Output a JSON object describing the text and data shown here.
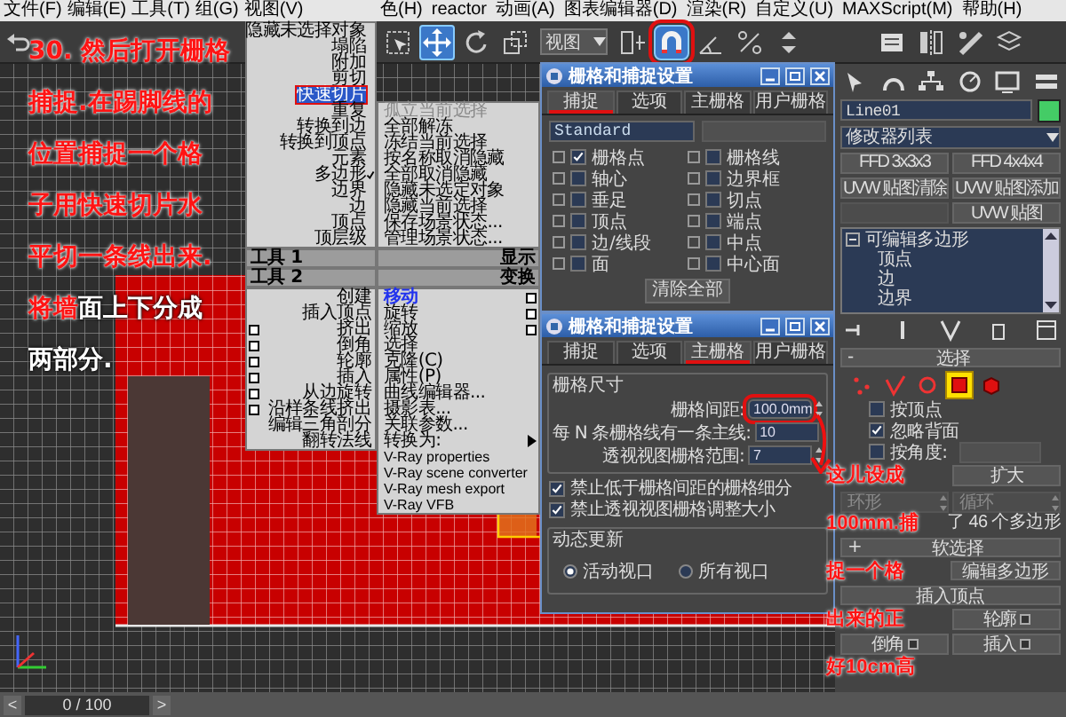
{
  "menu_bar": {
    "left_items": [
      "文件(F)",
      "编辑(E)",
      "工具(T)",
      "组(G)",
      "视图(V)"
    ],
    "right_items": [
      "色(H)",
      "reactor",
      "动画(A)",
      "图表编辑器(D)",
      "渲染(R)",
      "自定义(U)",
      "MAXScript(M)",
      "帮助(H)"
    ]
  },
  "toolbar": {
    "view_dropdown": "视图",
    "tools": [
      {
        "active": false
      },
      {
        "active": true
      },
      {
        "active": false
      },
      {
        "active": false
      },
      {
        "active": false
      },
      {
        "active": true
      },
      {
        "active": false
      },
      {
        "active": false
      },
      {
        "active": false
      },
      {
        "active": false
      },
      {
        "active": false
      },
      {
        "active": false
      },
      {
        "active": false
      }
    ]
  },
  "quad_menu": {
    "top_left": [
      {
        "label": "隐藏未选择对象",
        "checked": false,
        "highlighted": false
      },
      {
        "label": "塌陷",
        "checked": false,
        "highlighted": false
      },
      {
        "label": "附加",
        "checked": false,
        "highlighted": false
      },
      {
        "label": "剪切",
        "checked": false,
        "highlighted": false
      },
      {
        "label": "快速切片",
        "checked": false,
        "highlighted": true
      },
      {
        "label": "重复",
        "checked": false,
        "highlighted": false
      },
      {
        "label": "转换到边",
        "checked": false,
        "highlighted": false
      },
      {
        "label": "转换到顶点",
        "checked": false,
        "highlighted": false
      },
      {
        "label": "元素",
        "checked": false,
        "highlighted": false
      },
      {
        "label": "多边形",
        "checked": true,
        "highlighted": false
      },
      {
        "label": "边界",
        "checked": false,
        "highlighted": false
      },
      {
        "label": "边",
        "checked": false,
        "highlighted": false
      },
      {
        "label": "顶点",
        "checked": false,
        "highlighted": false
      },
      {
        "label": "顶层级",
        "checked": false,
        "highlighted": false
      }
    ],
    "top_right": [
      {
        "label": "孤立当前选择",
        "disabled": true
      },
      {
        "label": "全部解冻",
        "disabled": false
      },
      {
        "label": "冻结当前选择",
        "disabled": false
      },
      {
        "label": "按名称取消隐藏",
        "disabled": false
      },
      {
        "label": "全部取消隐藏",
        "disabled": false
      },
      {
        "label": "隐藏未选定对象",
        "disabled": false
      },
      {
        "label": "隐藏当前选择",
        "disabled": false
      },
      {
        "label": "保存场景状态...",
        "disabled": false
      },
      {
        "label": "管理场景状态...",
        "disabled": false
      }
    ],
    "headers": [
      "工具 1",
      "显示",
      "工具 2",
      "变换"
    ],
    "bottom_left": [
      {
        "label": "创建",
        "has_options": false
      },
      {
        "label": "插入顶点",
        "has_options": false
      },
      {
        "label": "挤出",
        "has_options": true
      },
      {
        "label": "倒角",
        "has_options": true
      },
      {
        "label": "轮廓",
        "has_options": true
      },
      {
        "label": "插入",
        "has_options": true
      },
      {
        "label": "从边旋转",
        "has_options": true
      },
      {
        "label": "沿样条线挤出",
        "has_options": true
      },
      {
        "label": "编辑三角剖分",
        "has_options": false
      },
      {
        "label": "翻转法线",
        "has_options": false
      }
    ],
    "bottom_right": [
      {
        "kind": "item",
        "label": "移动",
        "has_options": true,
        "current": true
      },
      {
        "kind": "item",
        "label": "旋转",
        "has_options": true,
        "current": false
      },
      {
        "kind": "item",
        "label": "缩放",
        "has_options": true,
        "current": false
      },
      {
        "kind": "item",
        "label": "选择",
        "has_options": false,
        "current": false
      },
      {
        "kind": "item",
        "label": "克隆(C)",
        "has_options": false,
        "current": false
      },
      {
        "kind": "item",
        "label": "属性(P)",
        "has_options": false,
        "current": false
      },
      {
        "kind": "item",
        "label": "曲线编辑器...",
        "has_options": false,
        "current": false
      },
      {
        "kind": "item",
        "label": "摄影表...",
        "has_options": false,
        "current": false
      },
      {
        "kind": "item",
        "label": "关联参数...",
        "has_options": false,
        "current": false
      },
      {
        "kind": "submenu",
        "label": "转换为:",
        "has_options": false,
        "current": false
      },
      {
        "kind": "item",
        "label": "V-Ray properties",
        "has_options": false,
        "current": false
      },
      {
        "kind": "item",
        "label": "V-Ray scene converter",
        "has_options": false,
        "current": false
      },
      {
        "kind": "item",
        "label": "V-Ray mesh export",
        "has_options": false,
        "current": false
      },
      {
        "kind": "item",
        "label": "V-Ray VFB",
        "has_options": false,
        "current": false
      }
    ]
  },
  "snap_dialog": {
    "title": "栅格和捕捉设置",
    "tabs": [
      {
        "label": "捕捉",
        "selected": true
      },
      {
        "label": "选项",
        "selected": false
      },
      {
        "label": "主栅格",
        "selected": false
      },
      {
        "label": "用户栅格",
        "selected": false
      }
    ],
    "preset": "Standard",
    "snaps": [
      {
        "label": "栅格点",
        "checked": true
      },
      {
        "label": "栅格线",
        "checked": false
      },
      {
        "label": "轴心",
        "checked": false
      },
      {
        "label": "边界框",
        "checked": false
      },
      {
        "label": "垂足",
        "checked": false
      },
      {
        "label": "切点",
        "checked": false
      },
      {
        "label": "顶点",
        "checked": false
      },
      {
        "label": "端点",
        "checked": false
      },
      {
        "label": "边/线段",
        "checked": false
      },
      {
        "label": "中点",
        "checked": false
      },
      {
        "label": "面",
        "checked": false
      },
      {
        "label": "中心面",
        "checked": false
      }
    ],
    "clear_button": "清除全部"
  },
  "grid_dialog": {
    "title": "栅格和捕捉设置",
    "tabs": [
      {
        "label": "捕捉",
        "selected": false
      },
      {
        "label": "选项",
        "selected": false
      },
      {
        "label": "主栅格",
        "selected": true
      },
      {
        "label": "用户栅格",
        "selected": false
      }
    ],
    "group_title": "栅格尺寸",
    "fields": [
      {
        "label": "栅格间距:",
        "value": "100.0mm"
      },
      {
        "label": "每 N 条栅格线有一条主线:",
        "value": "10"
      },
      {
        "label": "透视视图栅格范围:",
        "value": "7"
      }
    ],
    "options": [
      {
        "label": "禁止低于栅格间距的栅格细分",
        "checked": true
      },
      {
        "label": "禁止透视视图栅格调整大小",
        "checked": true
      }
    ],
    "update_title": "动态更新",
    "update_modes": [
      {
        "label": "活动视口",
        "selected": true
      },
      {
        "label": "所有视口",
        "selected": false
      }
    ]
  },
  "command_panel": {
    "object_name": "Line01",
    "modifier_list": "修改器列表",
    "modifier_buttons": [
      {
        "kind": "button",
        "label": "FFD 3x3x3"
      },
      {
        "kind": "button",
        "label": "FFD 4x4x4"
      },
      {
        "kind": "button",
        "label": "UVW 贴图清除"
      },
      {
        "kind": "button",
        "label": "UVW 贴图添加"
      },
      {
        "kind": "blank"
      },
      {
        "kind": "button",
        "label": "UVW 贴图"
      }
    ],
    "stack": {
      "label": "可编辑多边形",
      "expanded": true,
      "children": [
        {
          "label": "顶点"
        },
        {
          "label": "边"
        },
        {
          "label": "边界"
        }
      ]
    },
    "selection": {
      "sign": "-",
      "title": "选择",
      "levels": [
        {
          "selected": false
        },
        {
          "selected": false
        },
        {
          "selected": false
        },
        {
          "selected": true
        },
        {
          "selected": false
        }
      ],
      "options": [
        {
          "label": "按顶点",
          "checked": false
        },
        {
          "label": "忽略背面",
          "checked": true
        },
        {
          "label": "按角度:",
          "checked": false
        }
      ],
      "buttons": [
        {
          "kind": "blank"
        },
        {
          "kind": "button",
          "label": "扩大"
        }
      ],
      "spinners": [
        {
          "label": "环形"
        },
        {
          "label": "循环"
        }
      ],
      "count": "了 46 个多边形"
    },
    "soft_selection": {
      "sign": "+",
      "title": "软选择"
    },
    "edit_polygons": {
      "title": "编辑多边形",
      "insert_vertex": "插入顶点",
      "buttons": [
        {
          "kind": "blank"
        },
        {
          "kind": "button",
          "label": "轮廓"
        },
        {
          "kind": "button",
          "label": "倒角"
        },
        {
          "kind": "button",
          "label": "插入"
        }
      ]
    }
  },
  "timeline": {
    "prev": "<",
    "frame": "0 / 100",
    "next": ">"
  },
  "left_note": {
    "lines": [
      [
        {
          "text": "30. 然后打开栅格",
          "highlight": true
        }
      ],
      [
        {
          "text": "捕捉.在踢脚线的",
          "highlight": true
        }
      ],
      [
        {
          "text": "位置捕捉一个格",
          "highlight": true
        }
      ],
      [
        {
          "text": "子用快速切片水",
          "highlight": true
        }
      ],
      [
        {
          "text": "平切一条线出来.",
          "highlight": true
        }
      ],
      [
        {
          "text": "将墙",
          "highlight": true
        },
        {
          "text": "面上下分成",
          "highlight": false
        }
      ],
      [
        {
          "text": "两部分.",
          "highlight": false
        }
      ]
    ]
  },
  "right_note": {
    "lines": [
      [
        {
          "text": "这儿设成",
          "highlight": true
        }
      ],
      [
        {
          "text": "100mm.捕",
          "highlight": true
        }
      ],
      [
        {
          "text": "捉一个格",
          "highlight": true
        }
      ],
      [
        {
          "text": "出来的正",
          "highlight": true
        }
      ],
      [
        {
          "text": "好10cm高",
          "highlight": true
        }
      ]
    ]
  }
}
